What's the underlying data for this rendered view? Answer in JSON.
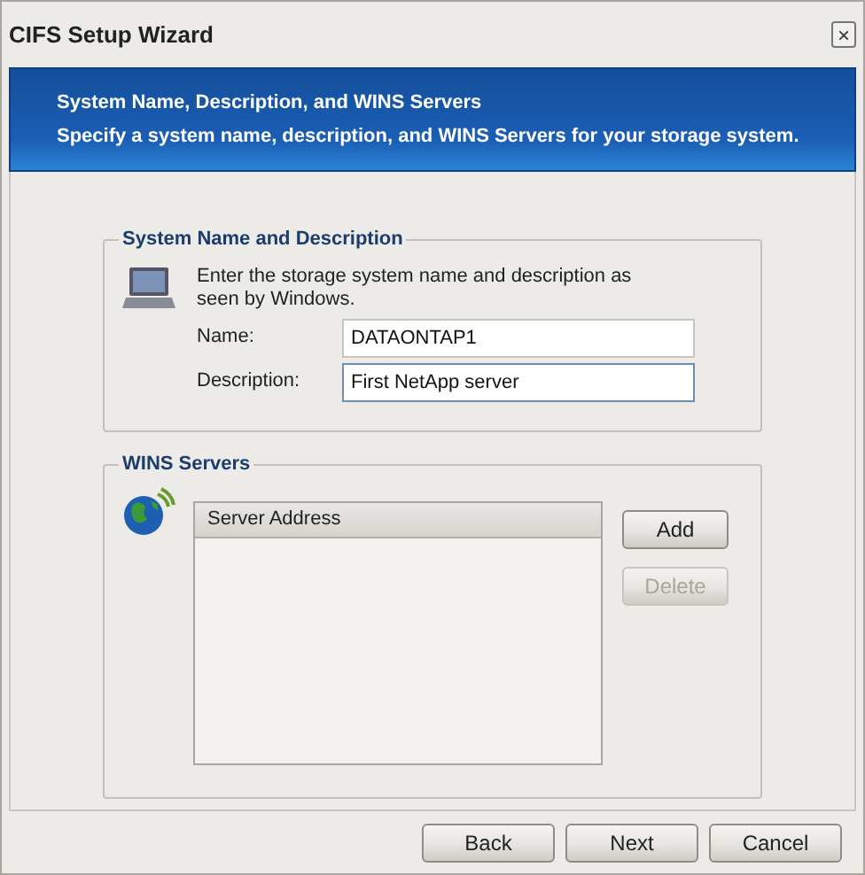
{
  "window": {
    "title": "CIFS Setup Wizard",
    "close": "×"
  },
  "banner": {
    "title": "System Name, Description, and WINS Servers",
    "subtitle": "Specify a system name, description, and WINS Servers for your storage system."
  },
  "system_group": {
    "legend": "System Name and Description",
    "instructions": "Enter the storage system name and description as seen by Windows.",
    "fields": [
      {
        "label": "Name:",
        "value": "DATAONTAP1",
        "focused": false
      },
      {
        "label": "Description:",
        "value": "First NetApp server",
        "focused": true
      }
    ]
  },
  "wins_group": {
    "legend": "WINS Servers",
    "columns": [
      "Server Address"
    ],
    "buttons": [
      {
        "label": "Add",
        "disabled": false
      },
      {
        "label": "Delete",
        "disabled": true
      }
    ]
  },
  "footer_buttons": [
    {
      "label": "Back",
      "disabled": false
    },
    {
      "label": "Next",
      "disabled": false
    },
    {
      "label": "Cancel",
      "disabled": false
    }
  ]
}
